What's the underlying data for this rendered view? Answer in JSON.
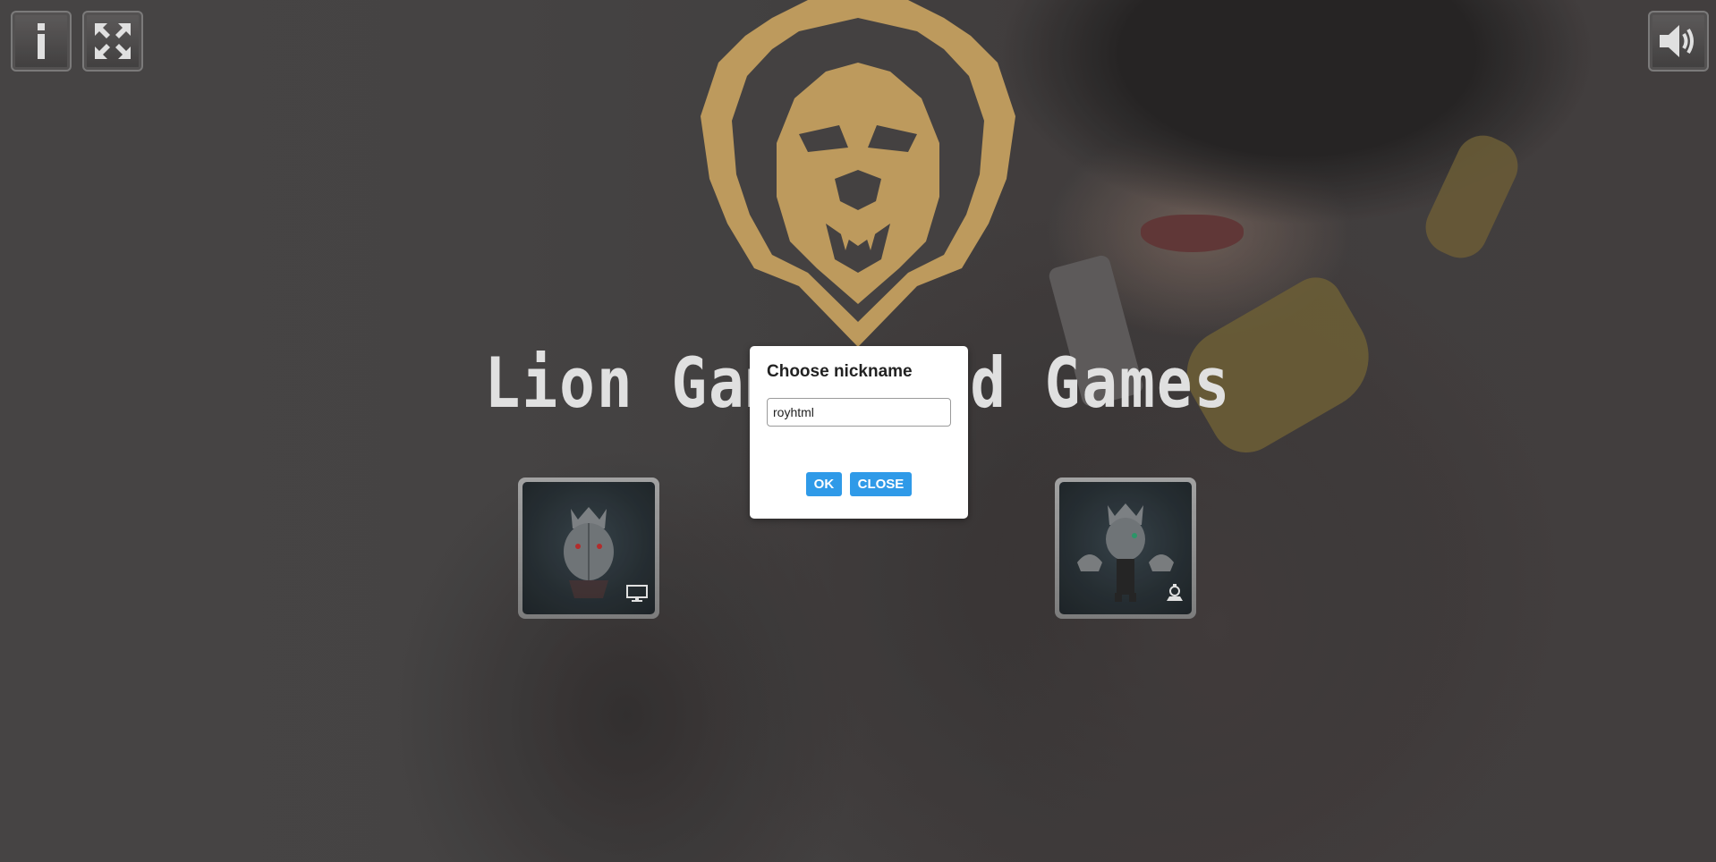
{
  "app": {
    "title": "Lion Games Old Games"
  },
  "hud": {
    "info_icon": "info-icon",
    "fullscreen_icon": "fullscreen-icon",
    "sound_icon": "speaker-icon"
  },
  "games": [
    {
      "mode_icon": "desktop-icon"
    },
    {
      "mode_icon": "multiplayer-icon"
    }
  ],
  "dialog": {
    "title": "Choose nickname",
    "nickname_value": "royhtml",
    "ok_label": "OK",
    "close_label": "CLOSE"
  },
  "colors": {
    "accent_gold": "#d8b06a",
    "button_blue": "#2f9ae8"
  }
}
